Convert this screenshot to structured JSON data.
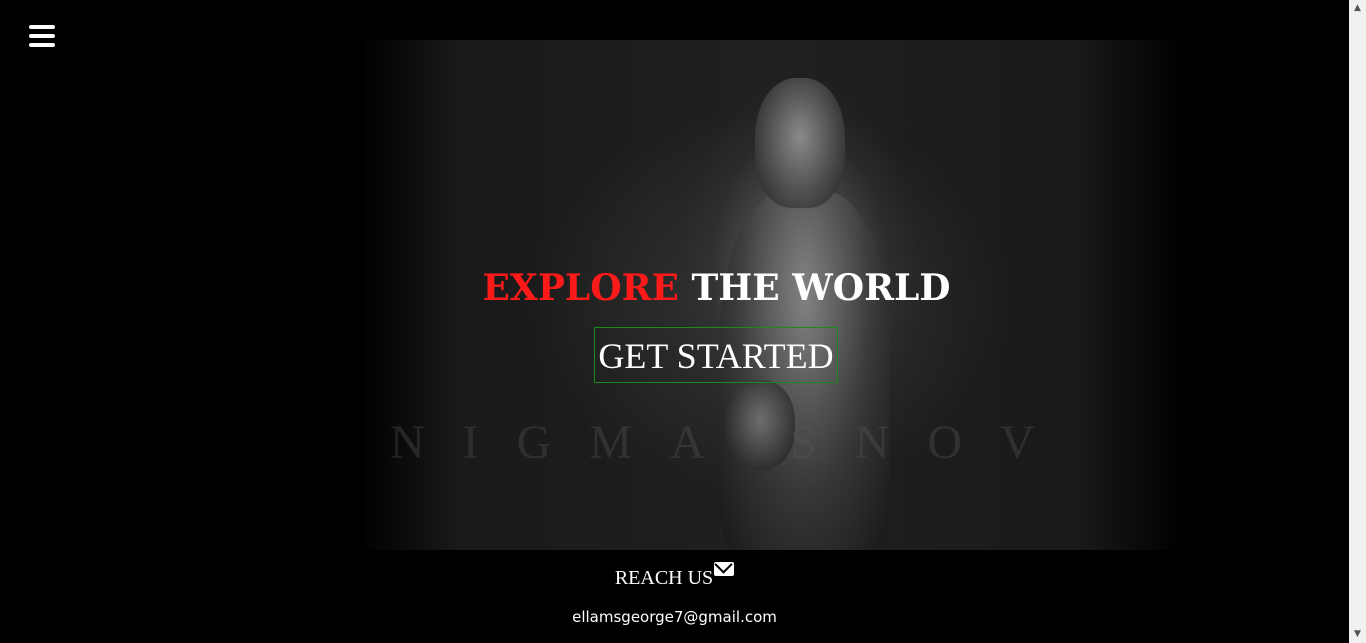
{
  "header": {
    "menu_icon": "hamburger-menu-icon"
  },
  "hero": {
    "headline_accent": "EXPLORE",
    "headline_rest": " THE WORLD",
    "cta_label": "GET STARTED",
    "watermark_text": "NIGMA   SNOV",
    "colors": {
      "accent": "#ff1a1a",
      "cta_border": "#1d8a1d",
      "text": "#ffffff",
      "background": "#000000"
    }
  },
  "footer": {
    "reach_label": "REACH US",
    "reach_icon": "envelope-icon",
    "email": "ellamsgeorge7@gmail.com"
  },
  "scrollbar": {
    "up_icon": "scroll-up-arrow-icon",
    "down_icon": "scroll-down-arrow-icon",
    "up_glyph": "▲",
    "down_glyph": "▼"
  }
}
